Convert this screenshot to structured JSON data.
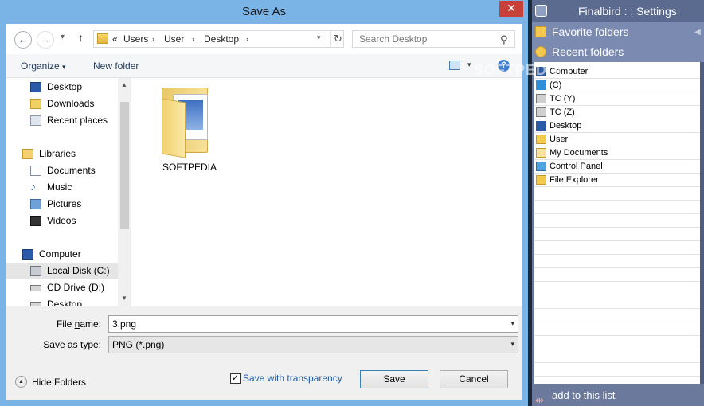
{
  "dialog": {
    "title": "Save As",
    "close_label": "✕",
    "nav": {
      "back_glyph": "←",
      "forward_glyph": "→",
      "recent_glyph": "▾",
      "up_glyph": "↑"
    },
    "address": {
      "prefix": "«",
      "segments": [
        "Users",
        "User",
        "Desktop"
      ],
      "separator": "›",
      "dropdown_glyph": "▾",
      "refresh_glyph": "↻"
    },
    "search": {
      "placeholder": "Search Desktop",
      "icon": "search-icon"
    },
    "toolbar": {
      "organize_label": "Organize",
      "organize_dd": "▾",
      "new_folder_label": "New folder",
      "view_dd": "▾",
      "help_label": "?"
    },
    "nav_pane": {
      "favorites": [
        {
          "label": "Desktop",
          "icon": "desktop-icon"
        },
        {
          "label": "Downloads",
          "icon": "downloads-icon"
        },
        {
          "label": "Recent places",
          "icon": "recent-places-icon"
        }
      ],
      "libraries_label": "Libraries",
      "libraries": [
        {
          "label": "Documents",
          "icon": "documents-icon"
        },
        {
          "label": "Music",
          "icon": "music-icon"
        },
        {
          "label": "Pictures",
          "icon": "pictures-icon"
        },
        {
          "label": "Videos",
          "icon": "videos-icon"
        }
      ],
      "computer_label": "Computer",
      "drives": [
        {
          "label": "Local Disk (C:)",
          "icon": "drive-icon",
          "selected": true
        },
        {
          "label": "CD Drive (D:)",
          "icon": "cd-drive-icon"
        },
        {
          "label": "Desktop",
          "icon": "drive-icon"
        }
      ],
      "scroll_up": "▲",
      "scroll_down": "▼"
    },
    "files": [
      {
        "name": "SOFTPEDIA",
        "icon": "folder-icon"
      }
    ],
    "file_name": {
      "label_pre": "File ",
      "label_u": "n",
      "label_post": "ame:",
      "value": "3.png",
      "dd": "▾"
    },
    "save_type": {
      "label_pre": "Save as ",
      "label_u": "t",
      "label_post": "ype:",
      "value": "PNG (*.png)",
      "dd": "▾"
    },
    "hide_folders_label": "Hide Folders",
    "hide_glyph": "▲",
    "transparency_label": "Save with transparency",
    "transparency_checked": "✓",
    "save_label": "Save",
    "cancel_label": "Cancel"
  },
  "finalbird": {
    "title": "Finalbird  : :  Settings",
    "favorite_folders_label": "Favorite folders",
    "recent_folders_label": "Recent folders",
    "collapse_glyph": "◀",
    "recent": [
      {
        "label": "Computer",
        "icon": "computer-icon"
      },
      {
        "label": "(C)",
        "icon": "windows-drive-icon"
      },
      {
        "label": "TC (Y)",
        "icon": "network-drive-icon"
      },
      {
        "label": "TC (Z)",
        "icon": "network-drive-icon"
      },
      {
        "label": "Desktop",
        "icon": "desktop-icon"
      },
      {
        "label": "User",
        "icon": "user-folder-icon"
      },
      {
        "label": "My Documents",
        "icon": "documents-icon"
      },
      {
        "label": "Control Panel",
        "icon": "control-panel-icon"
      },
      {
        "label": "File Explorer",
        "icon": "file-explorer-icon"
      }
    ],
    "add_label": "add to this list",
    "add_glyph": "⇹"
  },
  "watermark": "SOFTPEDIA"
}
